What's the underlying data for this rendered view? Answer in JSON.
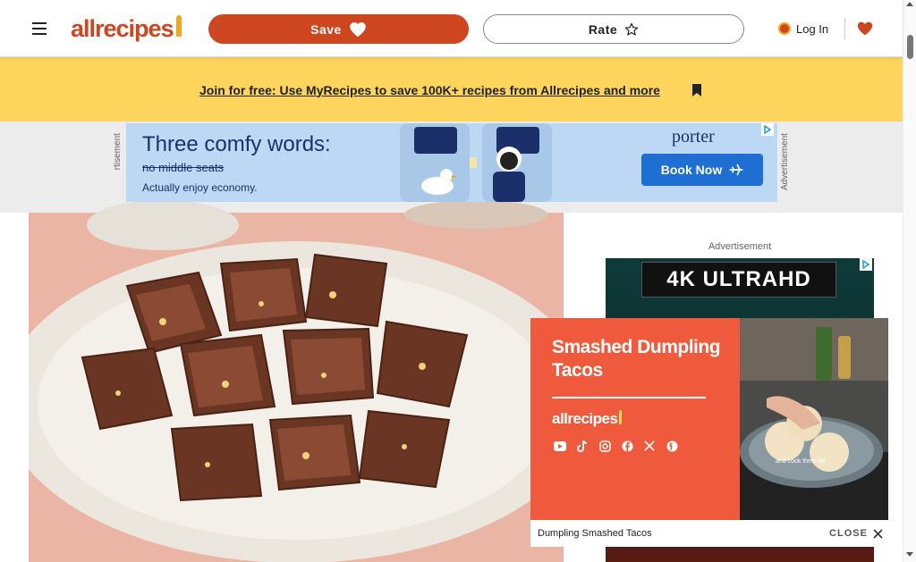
{
  "header": {
    "menu_icon": "hamburger-menu-icon",
    "logo_text": "allrecipes",
    "save_label": "Save",
    "save_icon": "heart-icon",
    "rate_label": "Rate",
    "rate_icon": "star-icon",
    "login_label": "Log In",
    "saved_icon": "heart-icon"
  },
  "banner": {
    "join_text": "Join for free: Use MyRecipes to save 100K+ recipes from Allrecipes and more",
    "close_icon": "x-icon"
  },
  "top_ad": {
    "side_label": "Advertisement",
    "headline": "Three comfy words:",
    "strike_text": "no middle seats",
    "subline": "Actually enjoy economy.",
    "brand": "porter",
    "cta_label": "Book Now"
  },
  "right_ad": {
    "label": "Advertisement",
    "badge_text": "4K ULTRAHD"
  },
  "video": {
    "title": "Smashed Dumpling Tacos",
    "logo_text": "allrecipes",
    "caption": "Dumpling Smashed Tacos",
    "close_label": "CLOSE",
    "overlay_text": "and cook them for"
  },
  "colors": {
    "brand_orange": "#ce4620",
    "banner_yellow": "#fdd55d",
    "video_orange": "#ef5a3c",
    "porter_blue": "#1f6ed4"
  }
}
